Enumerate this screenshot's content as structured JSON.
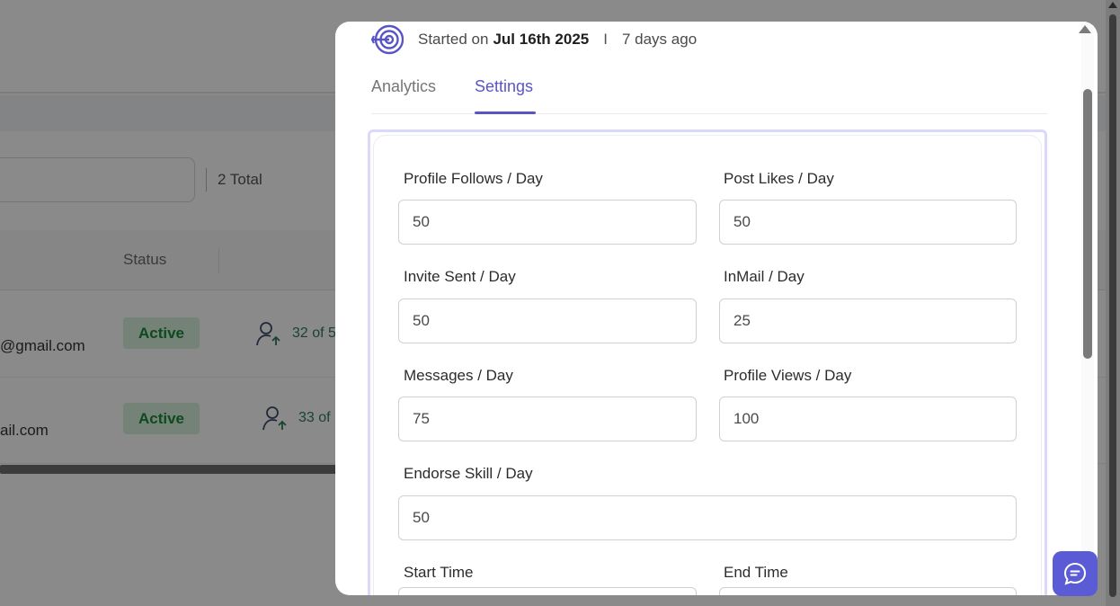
{
  "background": {
    "total_label": "2 Total",
    "status_header": "Status",
    "rows": [
      {
        "email": "@gmail.com",
        "status": "Active",
        "count": "32 of 5"
      },
      {
        "email": "ail.com",
        "status": "Active",
        "count": "33 of"
      }
    ]
  },
  "modal": {
    "started_prefix": "Started on",
    "started_date": "Jul 16th 2025",
    "separator": "I",
    "ago": "7 days ago",
    "tabs": [
      {
        "label": "Analytics",
        "active": false
      },
      {
        "label": "Settings",
        "active": true
      }
    ],
    "fields": {
      "profile_follows": {
        "label": "Profile Follows / Day",
        "value": "50"
      },
      "post_likes": {
        "label": "Post Likes / Day",
        "value": "50"
      },
      "invite_sent": {
        "label": "Invite Sent / Day",
        "value": "50"
      },
      "inmail": {
        "label": "InMail / Day",
        "value": "25"
      },
      "messages": {
        "label": "Messages / Day",
        "value": "75"
      },
      "profile_views": {
        "label": "Profile Views / Day",
        "value": "100"
      },
      "endorse_skill": {
        "label": "Endorse Skill / Day",
        "value": "50"
      },
      "start_time": {
        "label": "Start Time",
        "value": ""
      },
      "end_time": {
        "label": "End Time",
        "value": ""
      }
    }
  },
  "colors": {
    "accent": "#5a55c7",
    "active_badge_bg": "#d6f0dc",
    "active_badge_text": "#1c8a3a",
    "chat_button": "#5b5bd6"
  },
  "icons": {
    "campaign": "target-icon",
    "chat": "chat-bubble-icon",
    "user": "user-arrow-icon"
  }
}
